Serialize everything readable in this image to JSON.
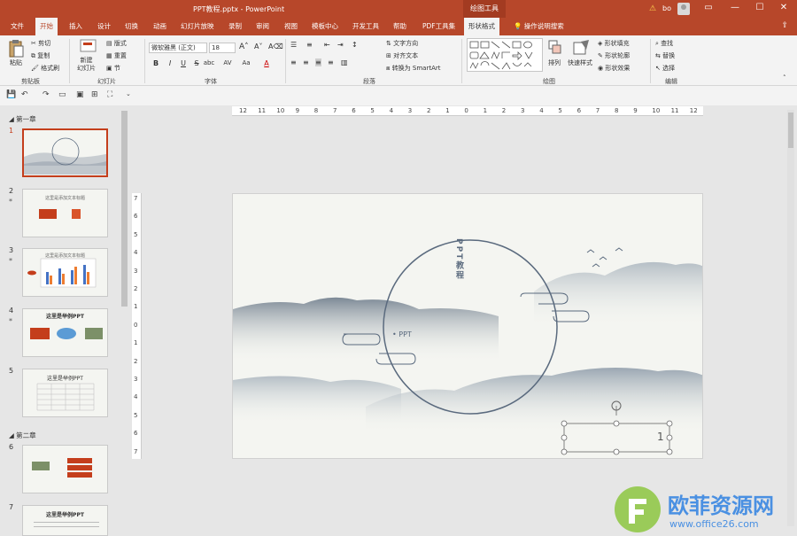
{
  "title": "PPT教程.pptx  -  PowerPoint",
  "context_tab": "绘图工具",
  "user": "bo",
  "window_controls": [
    "▭",
    "—",
    "☐",
    "✕"
  ],
  "menu": {
    "tabs": [
      "文件",
      "开始",
      "插入",
      "设计",
      "切换",
      "动画",
      "幻灯片放映",
      "录制",
      "审阅",
      "视图",
      "模板中心",
      "开发工具",
      "帮助",
      "PDF工具集",
      "形状格式"
    ],
    "active": "开始",
    "tell_me": "操作说明搜索"
  },
  "ribbon": {
    "clipboard": {
      "paste": "粘贴",
      "cut": "剪切",
      "copy": "复制",
      "format_painter": "格式刷",
      "label": "剪贴板"
    },
    "slides": {
      "new_slide": "新建\n幻灯片",
      "layout": "版式",
      "reset": "重置",
      "section": "节",
      "label": "幻灯片"
    },
    "font": {
      "name": "微软雅黑 (正文)",
      "size": "18",
      "bold": "B",
      "italic": "I",
      "underline": "U",
      "strike": "S",
      "shadow": "abc",
      "spacing": "AV",
      "case": "Aa",
      "color": "A",
      "label": "字体"
    },
    "paragraph": {
      "text_direction": "文字方向",
      "align_text": "对齐文本",
      "smartart": "转换为 SmartArt",
      "label": "段落"
    },
    "drawing": {
      "arrange": "排列",
      "quick_styles": "快速样式",
      "shape_fill": "形状填充",
      "shape_outline": "形状轮廓",
      "shape_effects": "形状效果",
      "label": "绘图"
    },
    "editing": {
      "find": "查找",
      "replace": "替换",
      "select": "选择",
      "label": "编辑"
    }
  },
  "sections": [
    "第一章",
    "第二章"
  ],
  "slides": [
    {
      "num": "1",
      "text": ""
    },
    {
      "num": "2",
      "text": "这里是添加文本标题"
    },
    {
      "num": "3",
      "text": "这里是添加文本标题"
    },
    {
      "num": "4",
      "text": "这里是举例PPT"
    },
    {
      "num": "5",
      "text": "这里是举例PPT"
    },
    {
      "num": "6",
      "text": ""
    },
    {
      "num": "7",
      "text": "这里是举例PPT"
    }
  ],
  "hruler": [
    "12",
    "11",
    "10",
    "9",
    "8",
    "7",
    "6",
    "5",
    "4",
    "3",
    "2",
    "1",
    "0",
    "1",
    "2",
    "3",
    "4",
    "5",
    "6",
    "7",
    "8",
    "9",
    "10",
    "11",
    "12"
  ],
  "vruler": [
    "7",
    "6",
    "5",
    "4",
    "3",
    "2",
    "1",
    "0",
    "1",
    "2",
    "3",
    "4",
    "5",
    "6",
    "7"
  ],
  "slide": {
    "vertical_title": "PPT教程",
    "bullet_text": "• PPT",
    "textbox_value": "1"
  },
  "watermark": {
    "cn": "欧菲资源网",
    "en": "www.office26.com"
  },
  "colors": {
    "accent": "#b7472a",
    "ink": "#5a6a7e",
    "selection": "#c43e1c"
  }
}
